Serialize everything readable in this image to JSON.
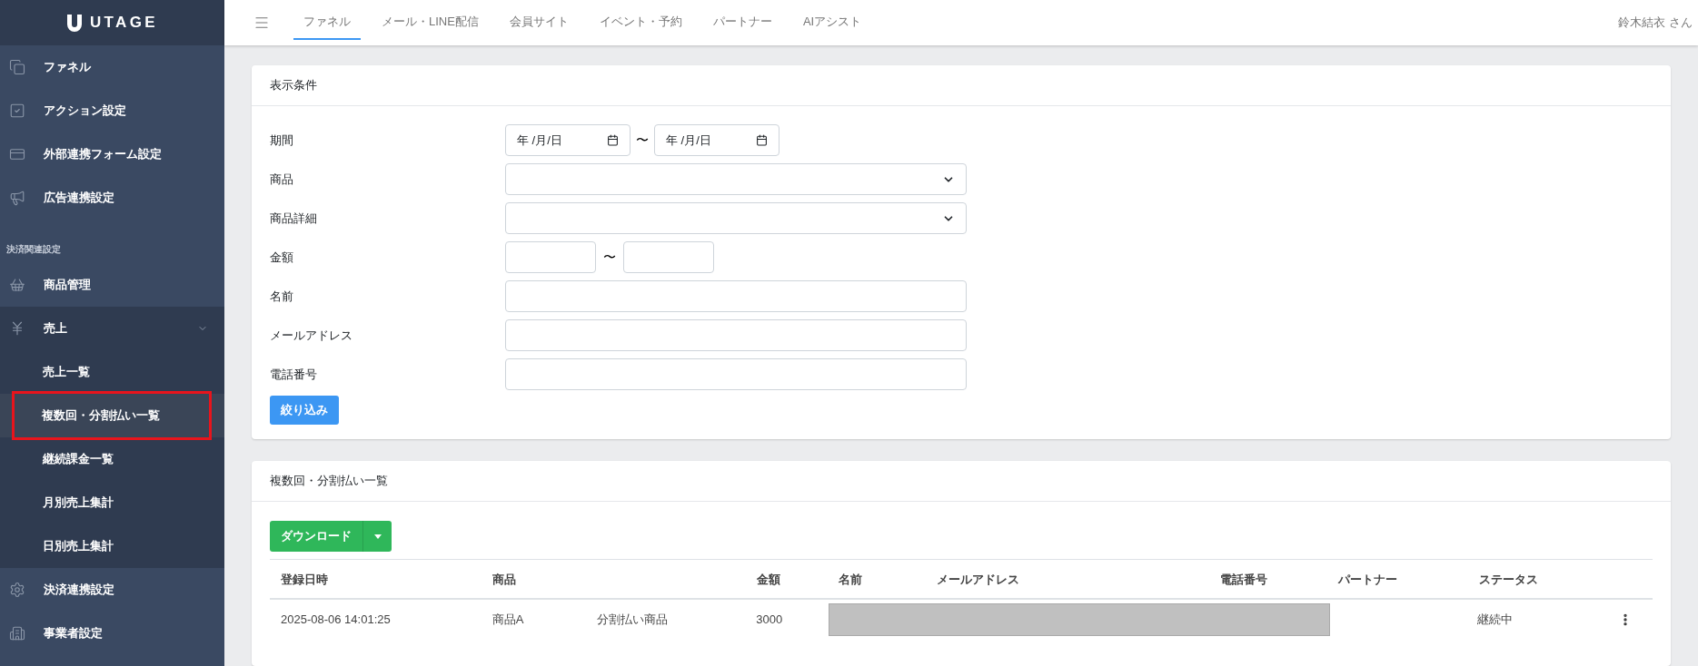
{
  "sidebar": {
    "logo": "UTAGE",
    "items": [
      {
        "kind": "item",
        "label": "ファネル"
      },
      {
        "kind": "item",
        "label": "アクション設定"
      },
      {
        "kind": "item",
        "label": "外部連携フォーム設定"
      },
      {
        "kind": "item",
        "label": "広告連携設定"
      },
      {
        "kind": "section",
        "label": "決済関連設定"
      },
      {
        "kind": "item",
        "label": "商品管理"
      },
      {
        "kind": "group",
        "label": "売上",
        "expanded": true,
        "children": [
          {
            "label": "売上一覧",
            "selected": false,
            "annotated": false
          },
          {
            "label": "複数回・分割払い一覧",
            "selected": true,
            "annotated": true
          },
          {
            "label": "継続課金一覧",
            "selected": false,
            "annotated": false
          },
          {
            "label": "月別売上集計",
            "selected": false,
            "annotated": false
          },
          {
            "label": "日別売上集計",
            "selected": false,
            "annotated": false
          }
        ]
      },
      {
        "kind": "item",
        "label": "決済連携設定"
      },
      {
        "kind": "item",
        "label": "事業者設定"
      }
    ]
  },
  "topbar": {
    "tabs": [
      {
        "label": "ファネル",
        "selected": true
      },
      {
        "label": "メール・LINE配信",
        "selected": false
      },
      {
        "label": "会員サイト",
        "selected": false
      },
      {
        "label": "イベント・予約",
        "selected": false
      },
      {
        "label": "パートナー",
        "selected": false
      },
      {
        "label": "AIアシスト",
        "selected": false
      }
    ],
    "user": "鈴木結衣 さん"
  },
  "filter_card": {
    "title": "表示条件",
    "fields": [
      {
        "kind": "daterange",
        "label": "期間",
        "from": "年 /月/日",
        "to": "年 /月/日",
        "separator": "〜"
      },
      {
        "kind": "select",
        "label": "商品"
      },
      {
        "kind": "select",
        "label": "商品詳細"
      },
      {
        "kind": "range",
        "label": "金額",
        "separator": "〜"
      },
      {
        "kind": "text",
        "label": "名前"
      },
      {
        "kind": "text",
        "label": "メールアドレス"
      },
      {
        "kind": "text",
        "label": "電話番号"
      }
    ],
    "submit": "絞り込み"
  },
  "list_card": {
    "title": "複数回・分割払い一覧",
    "download": "ダウンロード",
    "columns": [
      "登録日時",
      "商品",
      "金額",
      "名前",
      "メールアドレス",
      "電話番号",
      "パートナー",
      "ステータス"
    ],
    "rows": [
      {
        "date": "2025-08-06 14:01:25",
        "product": "商品A",
        "product_detail": "分割払い商品",
        "amount": "3000",
        "redacted": true,
        "status": "継続中"
      }
    ]
  }
}
